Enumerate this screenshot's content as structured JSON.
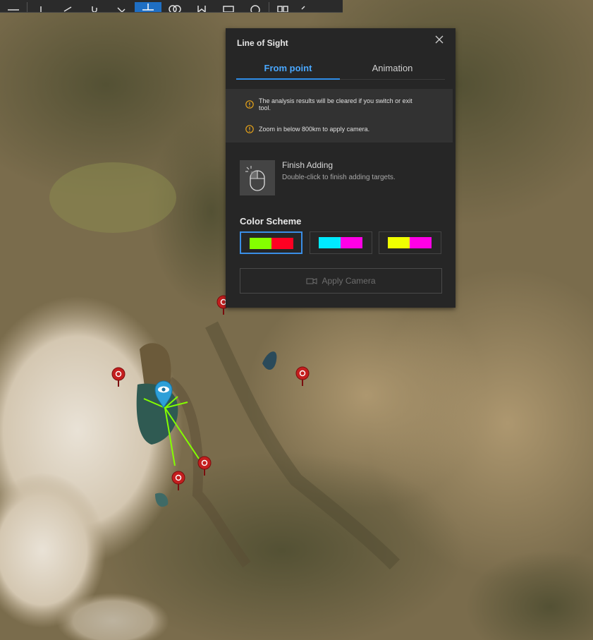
{
  "panel": {
    "title": "Line of Sight",
    "tabs": [
      {
        "label": "From point",
        "active": true
      },
      {
        "label": "Animation",
        "active": false
      }
    ],
    "notices": [
      "The analysis results will be cleared if you switch or exit tool.",
      "Zoom in below 800km to apply camera."
    ],
    "finish": {
      "title": "Finish Adding",
      "description": "Double-click to finish adding targets."
    },
    "color_scheme": {
      "title": "Color Scheme",
      "options": [
        {
          "colors": [
            "#84ff00",
            "#ff0022"
          ],
          "selected": true
        },
        {
          "colors": [
            "#00eaff",
            "#ff00e6"
          ],
          "selected": false
        },
        {
          "colors": [
            "#f0ff00",
            "#ff00e6"
          ],
          "selected": false
        }
      ]
    },
    "apply_camera_label": "Apply Camera"
  },
  "toolbar": {
    "icons": [
      "menu-icon",
      "pin-icon",
      "measure-icon",
      "paperclip-icon",
      "tag-icon",
      "line-of-sight-icon",
      "overlap-icon",
      "bookmark-icon",
      "image-icon",
      "globe-icon",
      "grid-icon",
      "chevron-left-icon"
    ],
    "active": "line-of-sight-icon"
  },
  "map": {
    "observer": "eye-icon",
    "target_icon": "target-icon",
    "visible_line_color": "#84ff00"
  }
}
